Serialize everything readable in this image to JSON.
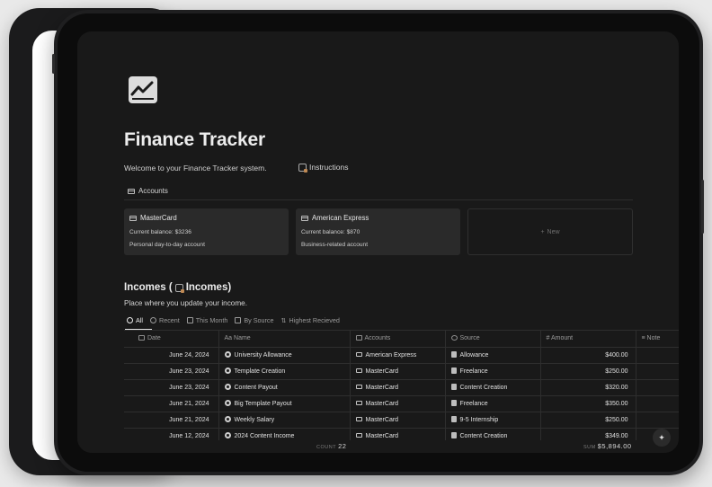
{
  "page": {
    "title": "Finance Tracker",
    "welcome": "Welcome to your Finance Tracker system.",
    "instructions_label": "Instructions"
  },
  "accounts": {
    "heading": "Accounts",
    "cards": [
      {
        "name": "MasterCard",
        "balance": "Current balance: $3236",
        "description": "Personal day-to-day account"
      },
      {
        "name": "American Express",
        "balance": "Current balance: $870",
        "description": "Business-related account"
      }
    ],
    "new_label": "New"
  },
  "incomes": {
    "title_prefix": "Incomes (",
    "title_suffix": "Incomes)",
    "subtitle": "Place where you update your income.",
    "views": [
      "All",
      "Recent",
      "This Month",
      "By Source",
      "Highest Recieved"
    ],
    "columns": [
      "Date",
      "Name",
      "Accounts",
      "Source",
      "Amount",
      "Note"
    ],
    "column_prefixes": [
      "",
      "Aa",
      "",
      "",
      "#",
      ""
    ],
    "rows": [
      {
        "date": "June 24, 2024",
        "name": "University Allowance",
        "account": "American Express",
        "source": "Allowance",
        "amount": "$400.00"
      },
      {
        "date": "June 23, 2024",
        "name": "Template Creation",
        "account": "MasterCard",
        "source": "Freelance",
        "amount": "$250.00"
      },
      {
        "date": "June 23, 2024",
        "name": "Content Payout",
        "account": "MasterCard",
        "source": "Content Creation",
        "amount": "$320.00"
      },
      {
        "date": "June 21, 2024",
        "name": "Big Template Payout",
        "account": "MasterCard",
        "source": "Freelance",
        "amount": "$350.00"
      },
      {
        "date": "June 21, 2024",
        "name": "Weekly Salary",
        "account": "MasterCard",
        "source": "9-5 Internship",
        "amount": "$250.00"
      },
      {
        "date": "June 12, 2024",
        "name": "2024 Content Income",
        "account": "MasterCard",
        "source": "Content Creation",
        "amount": "$349.00"
      }
    ],
    "footer": {
      "count_label": "COUNT",
      "count": "22",
      "sum_label": "SUM",
      "sum": "$5,894.00"
    }
  },
  "colors": {
    "screen_bg": "#191919",
    "card_bg": "#2a2a2a",
    "text": "#e6e6e6",
    "device": "#1f1f20"
  }
}
